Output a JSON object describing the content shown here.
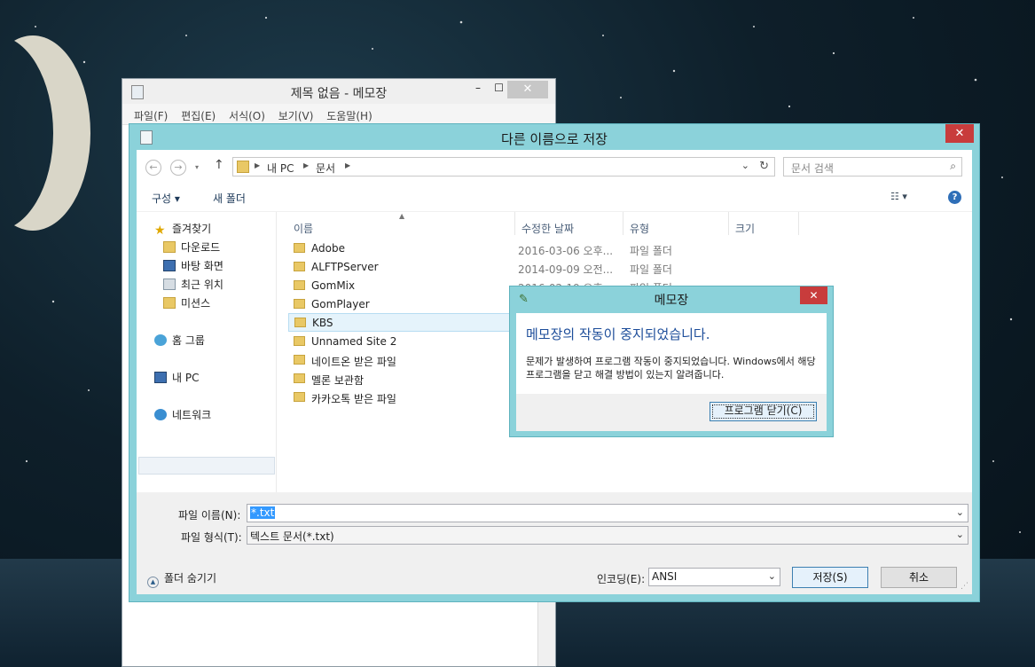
{
  "notepad": {
    "title": "제목 없음 - 메모장",
    "menu": [
      "파일(F)",
      "편집(E)",
      "서식(O)",
      "보기(V)",
      "도움말(H)"
    ]
  },
  "save_dialog": {
    "title": "다른 이름으로 저장",
    "breadcrumb": [
      "내 PC",
      "문서"
    ],
    "search_placeholder": "문서 검색",
    "toolbar": {
      "organize": "구성",
      "new_folder": "새 폴더"
    },
    "nav": {
      "favorites": "즐겨찾기",
      "downloads": "다운로드",
      "desktop": "바탕 화면",
      "recent": "최근 위치",
      "missions": "미션스",
      "homegroup": "홈 그룹",
      "this_pc": "내 PC",
      "network": "네트워크"
    },
    "columns": {
      "name": "이름",
      "modified": "수정한 날짜",
      "type": "유형",
      "size": "크기"
    },
    "files": [
      {
        "name": "Adobe",
        "date": "2016-03-06 오후...",
        "type": "파일 폴더"
      },
      {
        "name": "ALFTPServer",
        "date": "2014-09-09 오전...",
        "type": "파일 폴더"
      },
      {
        "name": "GomMix",
        "date": "2016-02-19 오후...",
        "type": "파일 폴더"
      },
      {
        "name": "GomPlayer",
        "date": "",
        "type": ""
      },
      {
        "name": "KBS",
        "date": "",
        "type": ""
      },
      {
        "name": "Unnamed Site 2",
        "date": "",
        "type": ""
      },
      {
        "name": "네이트온 받은 파일",
        "date": "",
        "type": ""
      },
      {
        "name": "멜론 보관함",
        "date": "",
        "type": ""
      },
      {
        "name": "카카오톡 받은 파일",
        "date": "",
        "type": ""
      }
    ],
    "filename_label": "파일 이름(N):",
    "filename_value": "*.txt",
    "filetype_label": "파일 형식(T):",
    "filetype_value": "텍스트 문서(*.txt)",
    "hide_folders": "폴더 숨기기",
    "encoding_label": "인코딩(E):",
    "encoding_value": "ANSI",
    "save_button": "저장(S)",
    "cancel_button": "취소"
  },
  "error_dialog": {
    "title": "메모장",
    "heading": "메모장의 작동이 중지되었습니다.",
    "message": "문제가 발생하여 프로그램 작동이 중지되었습니다. Windows에서 해당 프로그램을 닫고 해결 방법이 있는지 알려줍니다.",
    "close_button": "프로그램 닫기(C)"
  },
  "icons": {
    "close": "close-icon",
    "minimize": "minimize-icon",
    "maximize": "maximize-icon",
    "back": "back-arrow-icon",
    "forward": "forward-arrow-icon",
    "up": "up-arrow-icon",
    "refresh": "refresh-icon",
    "search": "search-icon",
    "folder": "folder-icon",
    "help": "help-icon",
    "view": "view-options-icon"
  }
}
